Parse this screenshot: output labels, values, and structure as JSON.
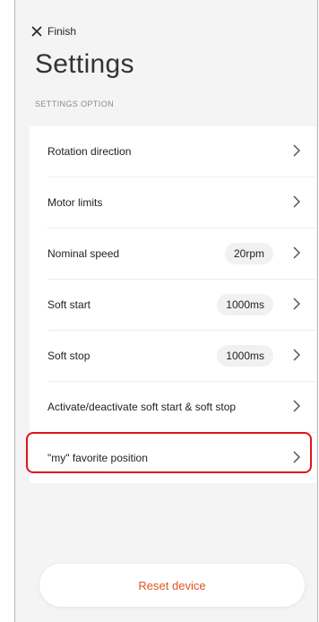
{
  "header": {
    "finish_label": "Finish",
    "title": "Settings",
    "section_label": "SETTINGS OPTION"
  },
  "settings": {
    "rows": [
      {
        "label": "Rotation direction",
        "value": ""
      },
      {
        "label": "Motor limits",
        "value": ""
      },
      {
        "label": "Nominal speed",
        "value": "20rpm"
      },
      {
        "label": "Soft start",
        "value": "1000ms"
      },
      {
        "label": "Soft stop",
        "value": "1000ms"
      },
      {
        "label": "Activate/deactivate soft start & soft stop",
        "value": ""
      },
      {
        "label": "\"my\" favorite position",
        "value": ""
      }
    ]
  },
  "footer": {
    "reset_label": "Reset device"
  },
  "colors": {
    "accent": "#e5531a",
    "highlight_border": "#e0141b",
    "background": "#f4f4f4",
    "card": "#ffffff"
  },
  "icons": {
    "close": "close-icon",
    "chevron": "chevron-right-icon"
  }
}
